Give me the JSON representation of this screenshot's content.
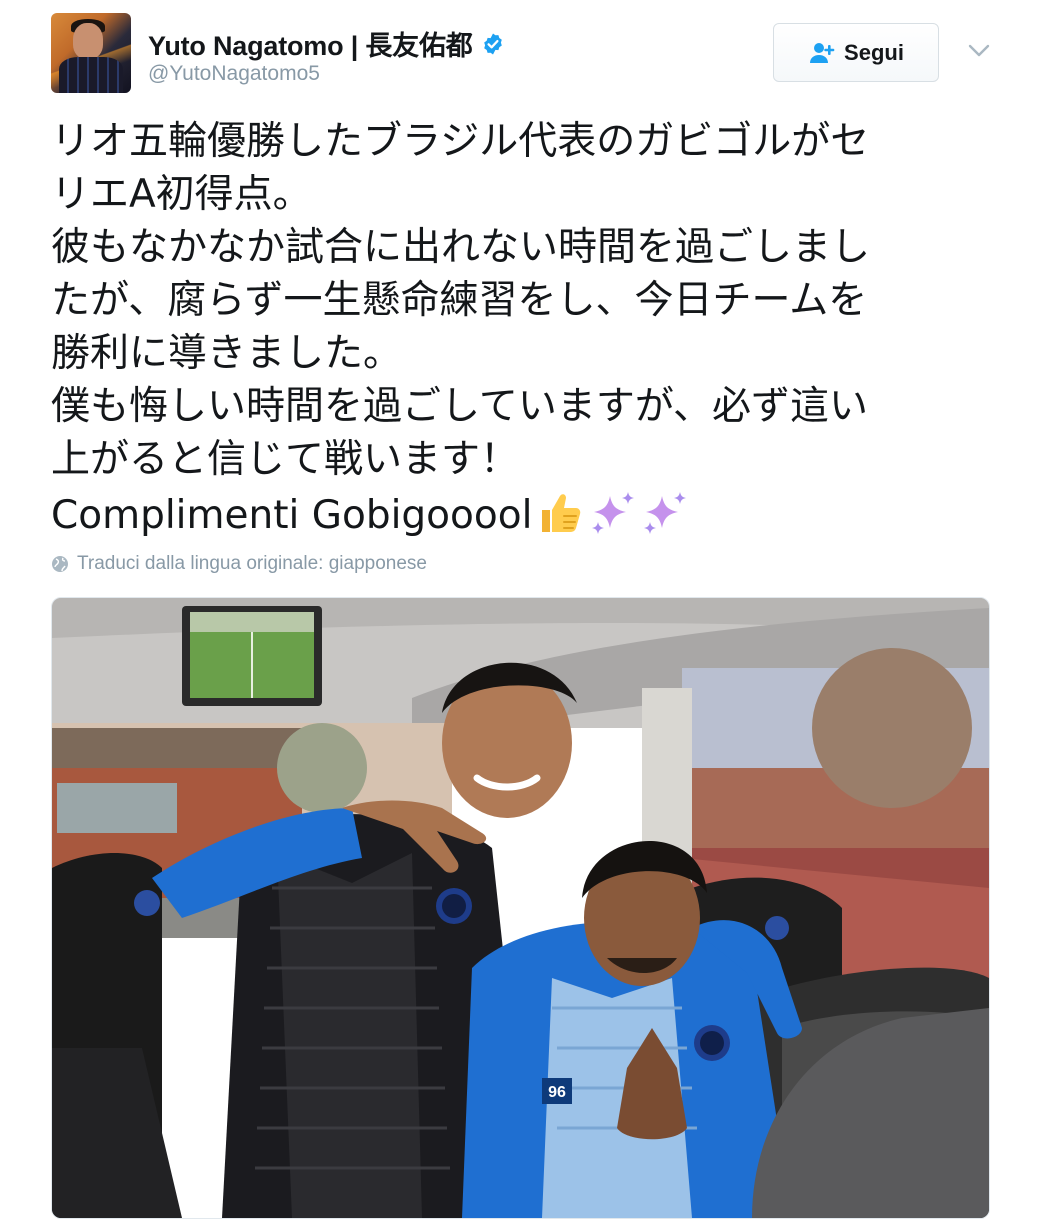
{
  "author": {
    "display_name": "Yuto Nagatomo | 長友佑都",
    "handle": "@YutoNagatomo5",
    "verified": true,
    "avatar_icon": "user-avatar"
  },
  "actions": {
    "follow_label": "Segui",
    "follow_icon": "add-user-icon",
    "more_icon": "chevron-down-icon"
  },
  "tweet": {
    "lines": [
      "リオ五輪優勝したブラジル代表のガビゴルがセ",
      "リエA初得点。",
      "彼もなかなか試合に出れない時間を過ごしまし",
      "たが、腐らず一生懸命練習をし、今日チームを",
      "勝利に導きました。",
      "僕も悔しい時間を過ごしていますが、必ず這い",
      "上がると信じて戦います！",
      "Complimenti Gobigooool"
    ],
    "trailing_emoji": [
      "thumbs-up",
      "sparkles",
      "sparkles"
    ]
  },
  "translate": {
    "label": "Traduci dalla lingua originale: giapponese",
    "icon": "globe-icon"
  },
  "media": {
    "type": "photo"
  },
  "colors": {
    "link_blue": "#1da1f2",
    "muted": "#8899a6",
    "text": "#14171a",
    "jersey_blue": "#1f6fd1"
  }
}
